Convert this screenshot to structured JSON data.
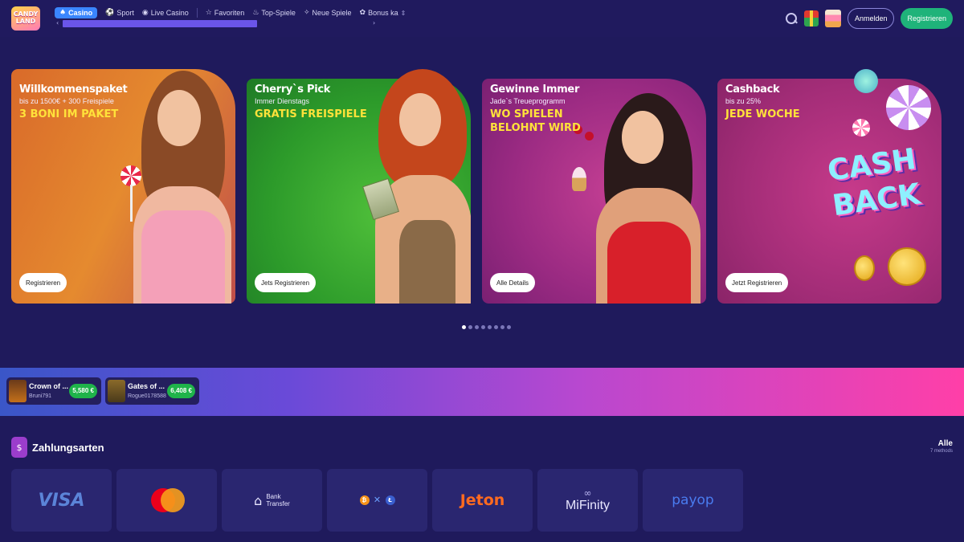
{
  "brand": {
    "logo_text": "CANDY LAND"
  },
  "nav": {
    "items": [
      {
        "label": "Casino",
        "icon": "spade-icon"
      },
      {
        "label": "Sport",
        "icon": "ball-icon"
      },
      {
        "label": "Live Casino",
        "icon": "live-icon"
      },
      {
        "label": "Favoriten",
        "icon": "star-icon"
      },
      {
        "label": "Top-Spiele",
        "icon": "flame-icon"
      },
      {
        "label": "Neue Spiele",
        "icon": "new-icon"
      },
      {
        "label": "Bonus ka",
        "icon": "bonus-icon"
      }
    ],
    "scroll_left": "‹",
    "scroll_right": "›"
  },
  "header": {
    "login_label": "Anmelden",
    "register_label": "Registrieren"
  },
  "promos": [
    {
      "title": "Willkommenspaket",
      "subtitle": "bis zu 1500€ + 300 Freispiele",
      "headline": "3 BONI IM PAKET",
      "cta": "Registrieren"
    },
    {
      "title": "Cherry`s Pick",
      "subtitle": "Immer Dienstags",
      "headline": "GRATIS FREISPIELE",
      "cta": "Jets Registrieren"
    },
    {
      "title": "Gewinne Immer",
      "subtitle": "Jade`s Treueprogramm",
      "headline": "WO SPIELEN BELOHNT WIRD",
      "cta": "Alle Details"
    },
    {
      "title": "Cashback",
      "subtitle": "bis zu 25%",
      "headline": "JEDE WOCHE",
      "cta": "Jetzt Registrieren",
      "art_text": "CASH BACK"
    }
  ],
  "carousel": {
    "dot_count": 8,
    "active_index": 0
  },
  "winners": [
    {
      "game": "Crown of ...",
      "user": "Bruni791",
      "amount": "5,580 €"
    },
    {
      "game": "Gates of ...",
      "user": "Rogue0178588",
      "amount": "6,408 €"
    }
  ],
  "payments": {
    "title": "Zahlungsarten",
    "all_label": "Alle",
    "count_label": "7 methods",
    "methods": [
      {
        "name": "VISA"
      },
      {
        "name": "Mastercard"
      },
      {
        "name": "Bank Transfer",
        "line1": "Bank",
        "line2": "Transfer"
      },
      {
        "name": "Crypto"
      },
      {
        "name": "Jeton"
      },
      {
        "name": "MiFinity"
      },
      {
        "name": "payop"
      }
    ]
  },
  "colors": {
    "background": "#1f1a5c",
    "accent_blue": "#3a86ff",
    "accent_green": "#1fb37a",
    "headline_yellow": "#ffe23a"
  }
}
